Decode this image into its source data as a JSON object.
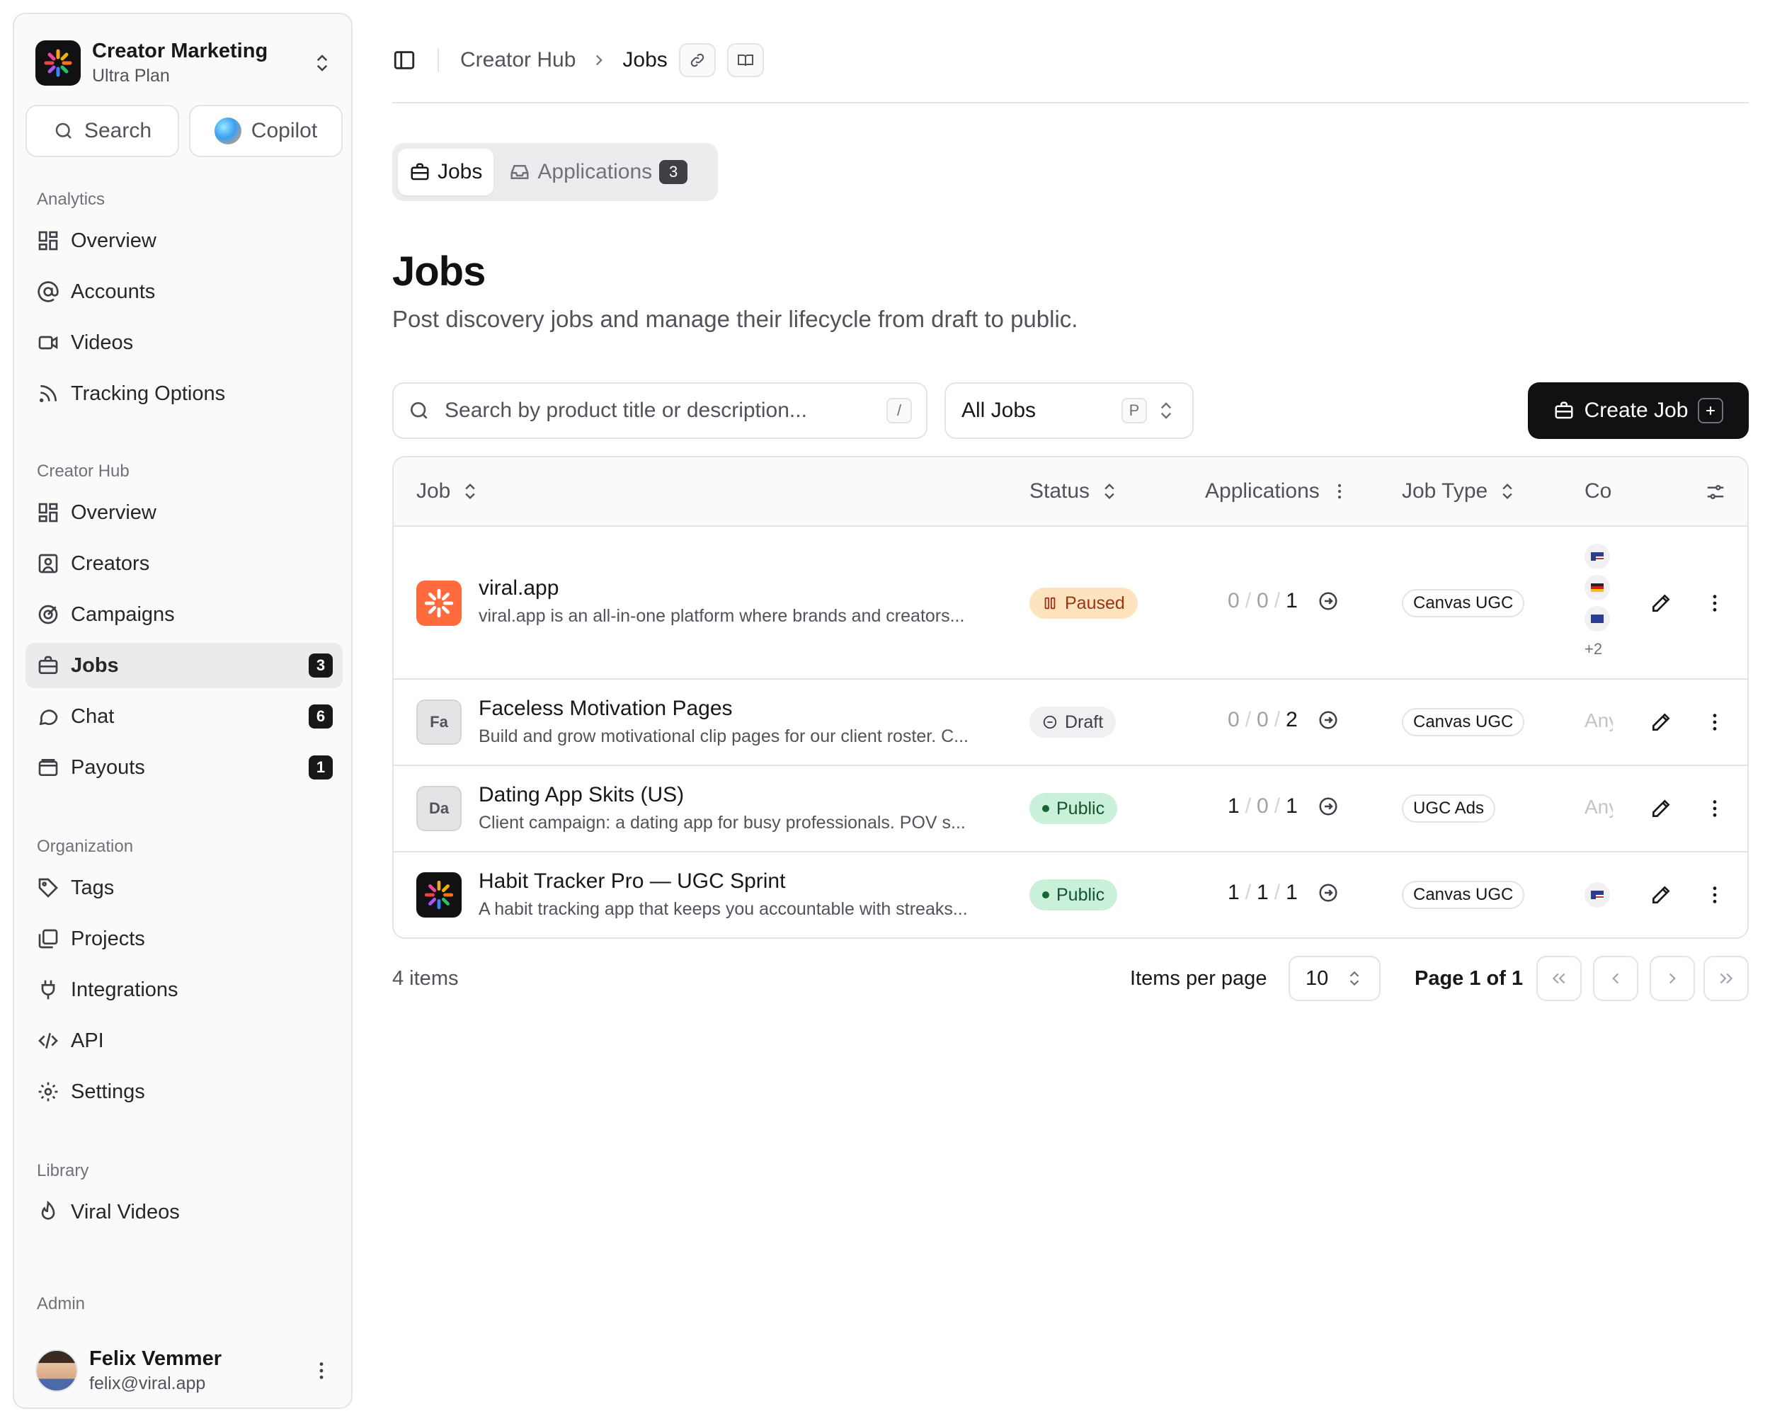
{
  "org": {
    "name": "Creator Marketing",
    "plan": "Ultra Plan"
  },
  "quick": {
    "search_label": "Search",
    "copilot_label": "Copilot"
  },
  "sidebar": {
    "analytics": {
      "heading": "Analytics",
      "items": [
        {
          "label": "Overview",
          "icon": "dashboard-icon"
        },
        {
          "label": "Accounts",
          "icon": "at-sign-icon"
        },
        {
          "label": "Videos",
          "icon": "video-icon"
        },
        {
          "label": "Tracking Options",
          "icon": "rss-icon"
        }
      ]
    },
    "hub": {
      "heading": "Creator Hub",
      "items": [
        {
          "label": "Overview",
          "icon": "dashboard-icon"
        },
        {
          "label": "Creators",
          "icon": "contact-icon"
        },
        {
          "label": "Campaigns",
          "icon": "target-icon"
        },
        {
          "label": "Jobs",
          "icon": "briefcase-icon",
          "badge": "3"
        },
        {
          "label": "Chat",
          "icon": "chat-icon",
          "badge": "6"
        },
        {
          "label": "Payouts",
          "icon": "wallet-icon",
          "badge": "1"
        }
      ]
    },
    "organization": {
      "heading": "Organization",
      "items": [
        {
          "label": "Tags",
          "icon": "tag-icon"
        },
        {
          "label": "Projects",
          "icon": "folders-icon"
        },
        {
          "label": "Integrations",
          "icon": "plug-icon"
        },
        {
          "label": "API",
          "icon": "code-icon"
        },
        {
          "label": "Settings",
          "icon": "gear-icon"
        }
      ]
    },
    "library": {
      "heading": "Library",
      "items": [
        {
          "label": "Viral Videos",
          "icon": "flame-icon"
        }
      ]
    },
    "admin": {
      "heading": "Admin"
    }
  },
  "user": {
    "name": "Felix Vemmer",
    "email": "felix@viral.app"
  },
  "breadcrumb": {
    "parent": "Creator Hub",
    "current": "Jobs"
  },
  "tabs": {
    "jobs": "Jobs",
    "applications": "Applications",
    "applications_count": "3"
  },
  "page": {
    "title": "Jobs",
    "subtitle": "Post discovery jobs and manage their lifecycle from draft to public."
  },
  "search": {
    "placeholder": "Search by product title or description...",
    "shortcut": "/"
  },
  "filter": {
    "value": "All Jobs",
    "shortcut": "P"
  },
  "create": {
    "label": "Create Job"
  },
  "table": {
    "headers": {
      "job": "Job",
      "status": "Status",
      "applications": "Applications",
      "job_type": "Job Type",
      "country": "Co"
    },
    "rows": [
      {
        "title": "viral.app",
        "desc": "viral.app is an all-in-one platform where brands and creators...",
        "thumb": "",
        "status": "Paused",
        "apps": [
          "0",
          "0",
          "1"
        ],
        "job_type": "Canvas UGC",
        "country": "",
        "flags_more": "+2"
      },
      {
        "title": "Faceless Motivation Pages",
        "desc": "Build and grow motivational clip pages for our client roster. C...",
        "thumb": "Fa",
        "status": "Draft",
        "apps": [
          "0",
          "0",
          "2"
        ],
        "job_type": "Canvas UGC",
        "country": "Any"
      },
      {
        "title": "Dating App Skits (US)",
        "desc": "Client campaign: a dating app for busy professionals. POV s...",
        "thumb": "Da",
        "status": "Public",
        "apps": [
          "1",
          "0",
          "1"
        ],
        "job_type": "UGC Ads",
        "country": "Any"
      },
      {
        "title": "Habit Tracker Pro — UGC Sprint",
        "desc": "A habit tracking app that keeps you accountable with streaks...",
        "thumb": "",
        "status": "Public",
        "apps": [
          "1",
          "1",
          "1"
        ],
        "job_type": "Canvas UGC",
        "country": ""
      }
    ]
  },
  "footer": {
    "count": "4 items",
    "ipp_label": "Items per page",
    "ipp_value": "10",
    "page_label": "Page 1 of 1"
  },
  "colors": {
    "accent_dark": "#111113",
    "paused_bg": "#fde4bf",
    "public_bg": "#c9f0d9",
    "brand_orange": "#ff6b3d"
  }
}
